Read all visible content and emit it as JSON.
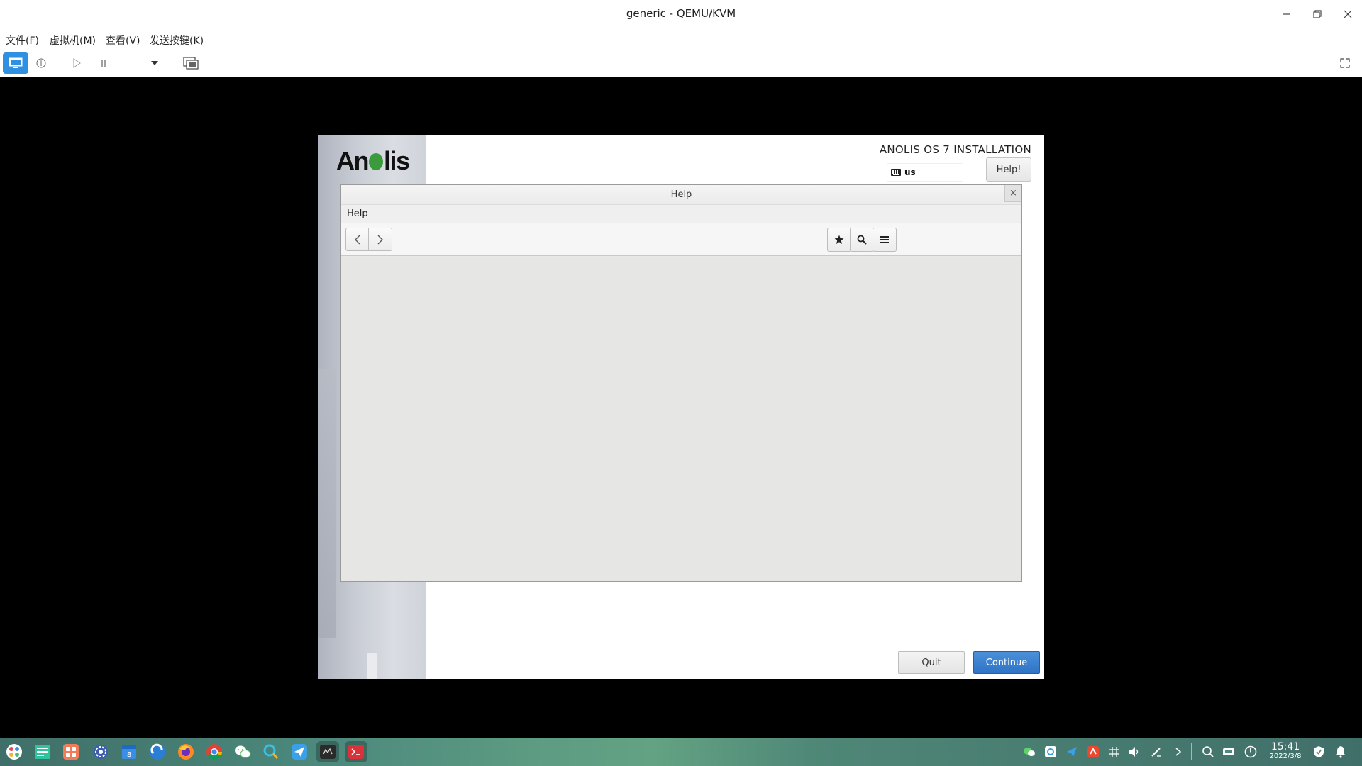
{
  "window": {
    "title": "generic - QEMU/KVM"
  },
  "menubar": {
    "file": "文件(F)",
    "vm": "虚拟机(M)",
    "view": "查看(V)",
    "sendkey": "发送按键(K)"
  },
  "installer": {
    "logo": {
      "part1": "An",
      "part2": "lis"
    },
    "title": "ANOLIS OS 7 INSTALLATION",
    "keyboard_layout": "us",
    "help_button": "Help!",
    "quit_button": "Quit",
    "continue_button": "Continue"
  },
  "help_dialog": {
    "title": "Help",
    "menu_label": "Help",
    "close_glyph": "×"
  },
  "taskbar": {
    "time": "15:41",
    "date": "2022/3/8"
  },
  "colors": {
    "accent": "#2f74c6",
    "taskbar": "#4d8a7d",
    "anolis_green": "#3a9a3c"
  }
}
